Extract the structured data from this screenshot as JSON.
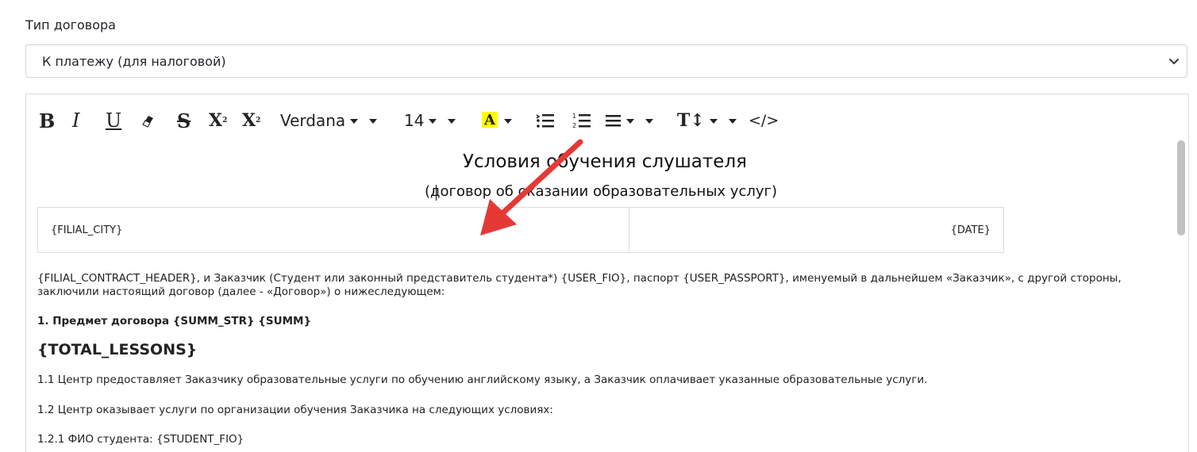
{
  "form": {
    "contract_type_label": "Тип договора",
    "contract_type_value": "К платежу (для налоговой)"
  },
  "toolbar": {
    "bold": "B",
    "italic": "I",
    "underline": "U",
    "strike": "S",
    "superscript": "X",
    "subscript": "X",
    "font_family": "Verdana",
    "font_size": "14",
    "color_letter": "A",
    "line_height": "T↕",
    "code_view": "</>"
  },
  "document": {
    "title": "Условия обучения слушателя",
    "subtitle": "(договор об оказании образовательных услуг)",
    "table": {
      "city": "{FILIAL_CITY}",
      "date": "{DATE}"
    },
    "paragraphs": {
      "intro": "{FILIAL_CONTRACT_HEADER}, и Заказчик (Студент или законный представитель студента*) {USER_FIO}, паспорт {USER_PASSPORT}, именуемый в дальнейшем «Заказчик», с другой стороны, заключили настоящий договор (далее - «Договор») о нижеследующем:",
      "section1": "1. Предмет договора {SUMM_STR} {SUMM}",
      "total_lessons": "{TOTAL_LESSONS}",
      "p1_1": "1.1 Центр предоставляет Заказчику образовательные услуги по обучению английскому языку, а Заказчик оплачивает указанные образовательные услуги.",
      "p1_2": "1.2 Центр оказывает услуги по организации обучения Заказчика на следующих условиях:",
      "p1_2_1": "1.2.1 ФИО студента: {STUDENT_FIO}"
    }
  },
  "colors": {
    "annotation_arrow": "#e53935",
    "highlight_yellow": "#ffff00"
  },
  "icons": [
    "eraser-icon",
    "bullet-list-icon",
    "numbered-list-icon",
    "align-icon",
    "chevron-down-icon",
    "annotation-arrow"
  ]
}
